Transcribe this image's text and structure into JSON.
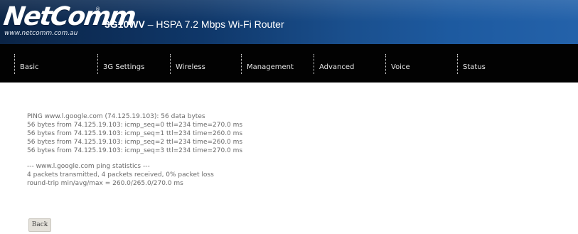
{
  "header": {
    "logo_text": "NetComm",
    "logo_registered": "®",
    "logo_url": "www.netcomm.com.au",
    "model": "3G10WV",
    "title_suffix": " – HSPA 7.2 Mbps Wi-Fi Router"
  },
  "nav": {
    "items": [
      {
        "label": "Basic"
      },
      {
        "label": "3G Settings"
      },
      {
        "label": "Wireless"
      },
      {
        "label": "Management"
      },
      {
        "label": "Advanced"
      },
      {
        "label": "Voice"
      },
      {
        "label": "Status"
      }
    ]
  },
  "ping": {
    "header_line": "PING www.l.google.com (74.125.19.103): 56 data bytes",
    "replies": [
      "56 bytes from 74.125.19.103: icmp_seq=0 ttl=234 time=270.0 ms",
      "56 bytes from 74.125.19.103: icmp_seq=1 ttl=234 time=260.0 ms",
      "56 bytes from 74.125.19.103: icmp_seq=2 ttl=234 time=260.0 ms",
      "56 bytes from 74.125.19.103: icmp_seq=3 ttl=234 time=270.0 ms"
    ],
    "stats_title": "--- www.l.google.com ping statistics ---",
    "packets_summary": "4 packets transmitted, 4 packets received, 0% packet loss",
    "round_trip": "round-trip min/avg/max = 260.0/265.0/270.0 ms"
  },
  "actions": {
    "back_label": "Back"
  },
  "colors": {
    "header_dark": "#0b2446",
    "header_light": "#2462aa",
    "navbar_bg": "#020202",
    "output_text": "#6a6a6a",
    "button_bg": "#e4e1da"
  }
}
